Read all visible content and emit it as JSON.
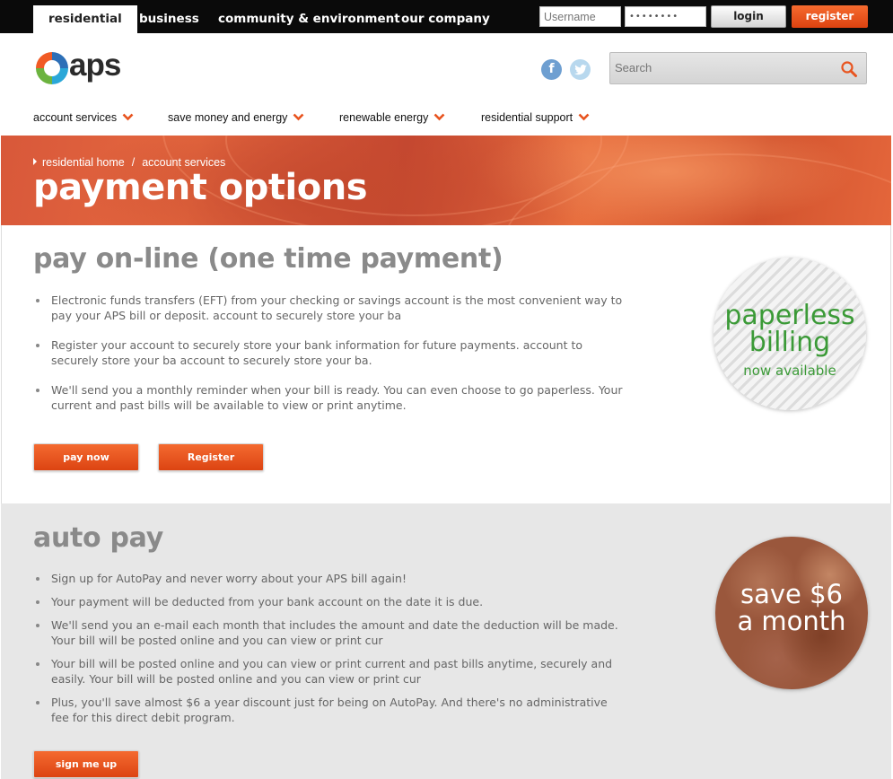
{
  "topbar": {
    "tabs": [
      "residential",
      "business",
      "community & environment",
      "our company"
    ],
    "active_tab": "residential",
    "username_placeholder": "Username",
    "password_value": "••••••••",
    "login_label": "login",
    "register_label": "register"
  },
  "header": {
    "logo_text": "aps",
    "search_placeholder": "Search"
  },
  "nav": {
    "items": [
      "account services",
      "save money and energy",
      "renewable energy",
      "residential support"
    ]
  },
  "banner": {
    "breadcrumb": [
      "residential home",
      "account services"
    ],
    "title": "payment options"
  },
  "pay_online": {
    "title": "pay on-line (one time payment)",
    "bullets": [
      "Electronic funds transfers (EFT) from your checking or savings account is the most convenient way to pay your APS bill or deposit. account to securely store your ba",
      "Register your account to securely store your bank information for future payments. account to securely store your ba account to securely store your ba.",
      "We'll send you a monthly reminder when your bill is ready. You can even choose to go paperless. Your current and past bills will be available to view or print anytime."
    ],
    "pay_now_label": "pay now",
    "register_label": "Register",
    "badge": {
      "line1": "paperless",
      "line2": "billing",
      "line3": "now available"
    }
  },
  "auto_pay": {
    "title": "auto pay",
    "bullets": [
      "Sign up for AutoPay and never worry about your APS bill again!",
      "Your payment will be deducted from your bank account on the date it is due.",
      "We'll send you an e-mail each month that includes the amount and date the deduction will be made. Your bill will be posted online and you can view or print cur",
      "Your bill will be posted online and you can view or print current and past bills anytime, securely and easily. Your bill will be posted online and you can view or print cur",
      "Plus, you'll save almost $6 a year discount just for being on AutoPay. And there's no administrative fee for this direct debit program."
    ],
    "sign_up_label": "sign me up",
    "badge": {
      "line1": "save $6",
      "line2": "a month"
    }
  },
  "colors": {
    "accent_orange": "#e8541f",
    "badge_green": "#3b9a37",
    "heading_gray": "#8a8a8a"
  },
  "icons": [
    "facebook-icon",
    "twitter-icon",
    "search-icon",
    "chevron-down-icon",
    "aps-logo-icon"
  ]
}
